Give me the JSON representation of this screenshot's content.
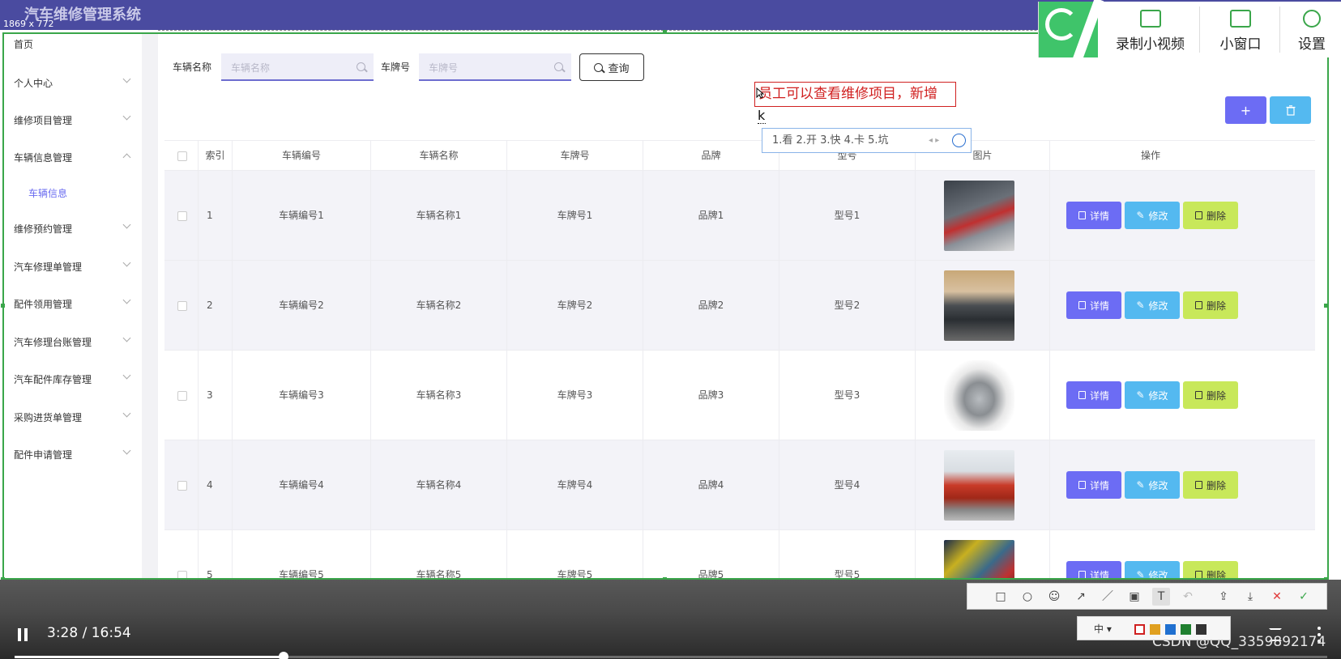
{
  "header": {
    "app_title": "汽车维修管理系统",
    "dimension_readout": "1869 x 772"
  },
  "sidebar": {
    "items": [
      {
        "label": "首页",
        "expandable": false
      },
      {
        "label": "个人中心",
        "expandable": true
      },
      {
        "label": "维修项目管理",
        "expandable": true
      },
      {
        "label": "车辆信息管理",
        "expandable": true,
        "expanded": true,
        "children": [
          "车辆信息"
        ]
      },
      {
        "label": "维修预约管理",
        "expandable": true
      },
      {
        "label": "汽车修理单管理",
        "expandable": true
      },
      {
        "label": "配件领用管理",
        "expandable": true
      },
      {
        "label": "汽车修理台账管理",
        "expandable": true
      },
      {
        "label": "汽车配件库存管理",
        "expandable": true
      },
      {
        "label": "采购进货单管理",
        "expandable": true
      },
      {
        "label": "配件申请管理",
        "expandable": true
      }
    ]
  },
  "search": {
    "vehicle_name_label": "车辆名称",
    "vehicle_name_placeholder": "车辆名称",
    "plate_label": "车牌号",
    "plate_placeholder": "车牌号",
    "query_button": "查询"
  },
  "toolbar": {
    "add_icon": "+",
    "delete_icon": "trash-icon"
  },
  "table": {
    "columns": [
      "索引",
      "车辆编号",
      "车辆名称",
      "车牌号",
      "品牌",
      "型号",
      "图片",
      "操作"
    ],
    "rows": [
      {
        "index": "1",
        "vehicle_no": "车辆编号1",
        "vehicle_name": "车辆名称1",
        "plate": "车牌号1",
        "brand": "品牌1",
        "model": "型号1",
        "image": "red sports car"
      },
      {
        "index": "2",
        "vehicle_no": "车辆编号2",
        "vehicle_name": "车辆名称2",
        "plate": "车牌号2",
        "brand": "品牌2",
        "model": "型号2",
        "image": "grey muscle car"
      },
      {
        "index": "3",
        "vehicle_no": "车辆编号3",
        "vehicle_name": "车辆名称3",
        "plate": "车牌号3",
        "brand": "品牌3",
        "model": "型号3",
        "image": "silver SUV"
      },
      {
        "index": "4",
        "vehicle_no": "车辆编号4",
        "vehicle_name": "车辆名称4",
        "plate": "车牌号4",
        "brand": "品牌4",
        "model": "型号4",
        "image": "red SUV"
      },
      {
        "index": "5",
        "vehicle_no": "车辆编号5",
        "vehicle_name": "车辆名称5",
        "plate": "车牌号5",
        "brand": "品牌5",
        "model": "型号5",
        "image": "wrapped car"
      }
    ],
    "actions": {
      "detail": "详情",
      "edit": "修改",
      "delete": "删除"
    }
  },
  "annotation": {
    "text": "员工可以查看维修项目，新增",
    "ime_input": "k",
    "ime_candidates": "1.看 2.开 3.快 4.卡 5.坑"
  },
  "recorder": {
    "record": "录制小视频",
    "mini_window": "小窗口",
    "settings": "设置"
  },
  "video": {
    "time": "3:28 / 16:54",
    "progress_fraction": 0.205
  },
  "snip_toolbar": {
    "size_label": "中",
    "colors": [
      "#d02020",
      "#e0a020",
      "#2070d0",
      "#208030",
      "#333333"
    ]
  },
  "watermark": "CSDN @QQ_3359892174",
  "colors": {
    "header": "#4a4ba0",
    "accent": "#6c6cf4",
    "edit": "#54b9f0",
    "delete": "#c8e85a",
    "capture_frame": "#3aa64a"
  }
}
